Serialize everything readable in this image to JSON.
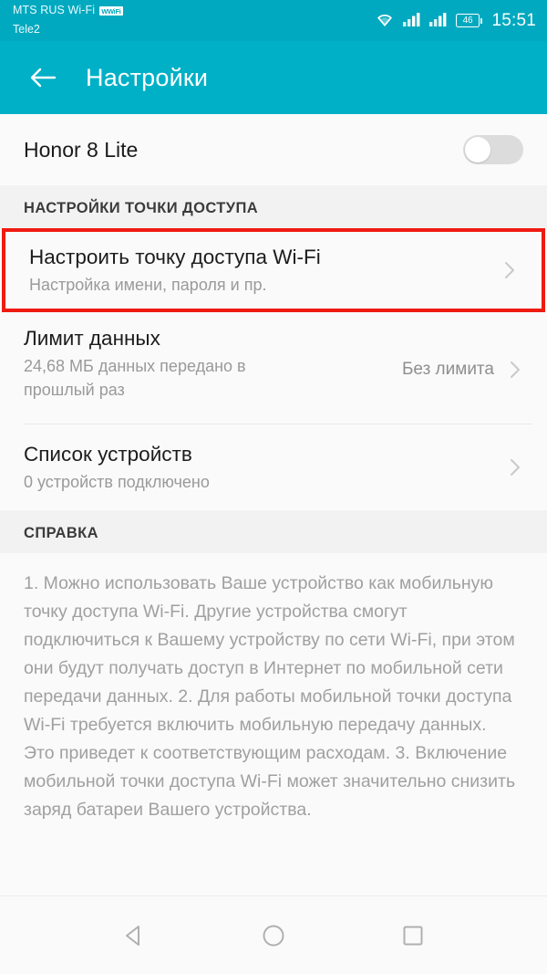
{
  "status_bar": {
    "carrier_wifi": "MTS RUS Wi-Fi",
    "wifi_badge": "WWiFi",
    "carrier_mobile": "Tele2",
    "battery_percent": "46",
    "time": "15:51",
    "icons": [
      "wifi-icon",
      "signal-icon-sim1",
      "signal-icon-sim2",
      "battery-icon"
    ],
    "accent_color": "#00a9bf"
  },
  "app_bar": {
    "back_label": "back-arrow-icon",
    "title": "Настройки",
    "background_color": "#00b0c7"
  },
  "device_row": {
    "title": "Honor 8 Lite",
    "toggle_state": "off"
  },
  "hotspot_section": {
    "header": "НАСТРОЙКИ ТОЧКИ ДОСТУПА",
    "highlight_color": "#ee1b11",
    "items": [
      {
        "title": "Настроить точку доступа Wi-Fi",
        "subtitle": "Настройка имени, пароля и пр.",
        "value": "",
        "highlighted": true
      },
      {
        "title": "Лимит данных",
        "subtitle": "24,68 МБ данных передано в прошлый раз",
        "value": "Без лимита",
        "highlighted": false
      },
      {
        "title": "Список устройств",
        "subtitle": "0 устройств подключено",
        "value": "",
        "highlighted": false
      }
    ]
  },
  "help_section": {
    "header": "СПРАВКА",
    "body": "1. Можно использовать Ваше устройство как мобильную точку доступа Wi-Fi. Другие устройства смогут подключиться к Вашему устройству по сети Wi-Fi, при этом они будут получать доступ в Интернет по мобильной сети передачи данных.\n2. Для работы мобильной точки доступа Wi-Fi требуется включить мобильную передачу данных. Это приведет к соответствующим расходам.\n3. Включение мобильной точки доступа Wi-Fi может значительно снизить заряд батареи Вашего устройства."
  },
  "nav_bar": {
    "buttons": [
      "back-triangle-icon",
      "home-circle-icon",
      "recents-square-icon"
    ]
  }
}
